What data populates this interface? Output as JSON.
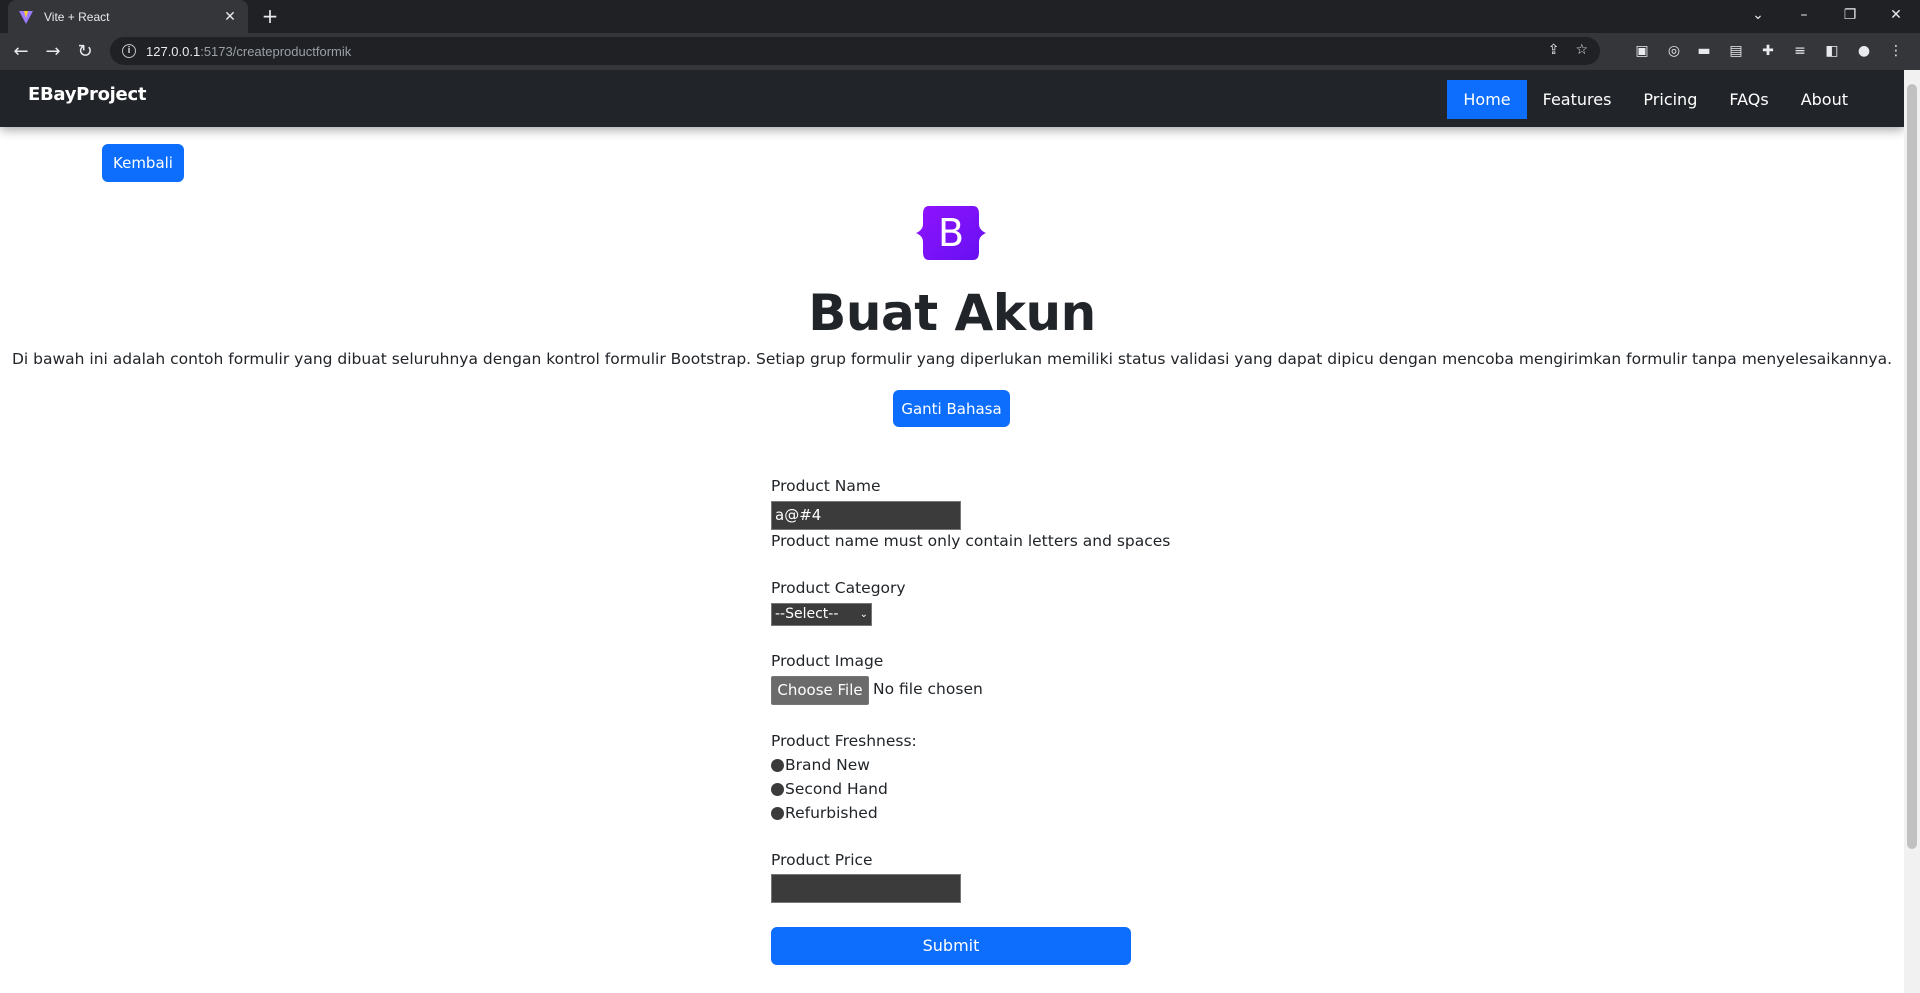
{
  "browser": {
    "tab_title": "Vite + React",
    "url_host": "127.0.0.1",
    "url_path": ":5173/createproductformik"
  },
  "navbar": {
    "brand": "EBayProject",
    "links": [
      "Home",
      "Features",
      "Pricing",
      "FAQs",
      "About"
    ],
    "active": "Home"
  },
  "page": {
    "back_button": "Kembali",
    "logo_letter": "B",
    "title": "Buat Akun",
    "description": "Di bawah ini adalah contoh formulir yang dibuat seluruhnya dengan kontrol formulir Bootstrap. Setiap grup formulir yang diperlukan memiliki status validasi yang dapat dipicu dengan mencoba mengirimkan formulir tanpa menyelesaikannya.",
    "language_button": "Ganti Bahasa"
  },
  "form": {
    "product_name_label": "Product Name",
    "product_name_value": "a@#4",
    "product_name_error": "Product name must only contain letters and spaces",
    "product_category_label": "Product Category",
    "product_category_selected": "--Select--",
    "product_image_label": "Product Image",
    "choose_file_label": "Choose File",
    "no_file_text": "No file chosen",
    "freshness_label": "Product Freshness:",
    "freshness_options": [
      "Brand New",
      "Second Hand",
      "Refurbished"
    ],
    "product_price_label": "Product Price",
    "product_price_value": "",
    "submit_label": "Submit"
  },
  "colors": {
    "primary": "#0d6efd",
    "navbar_bg": "#212529",
    "bootstrap_purple": "#7952b3"
  }
}
